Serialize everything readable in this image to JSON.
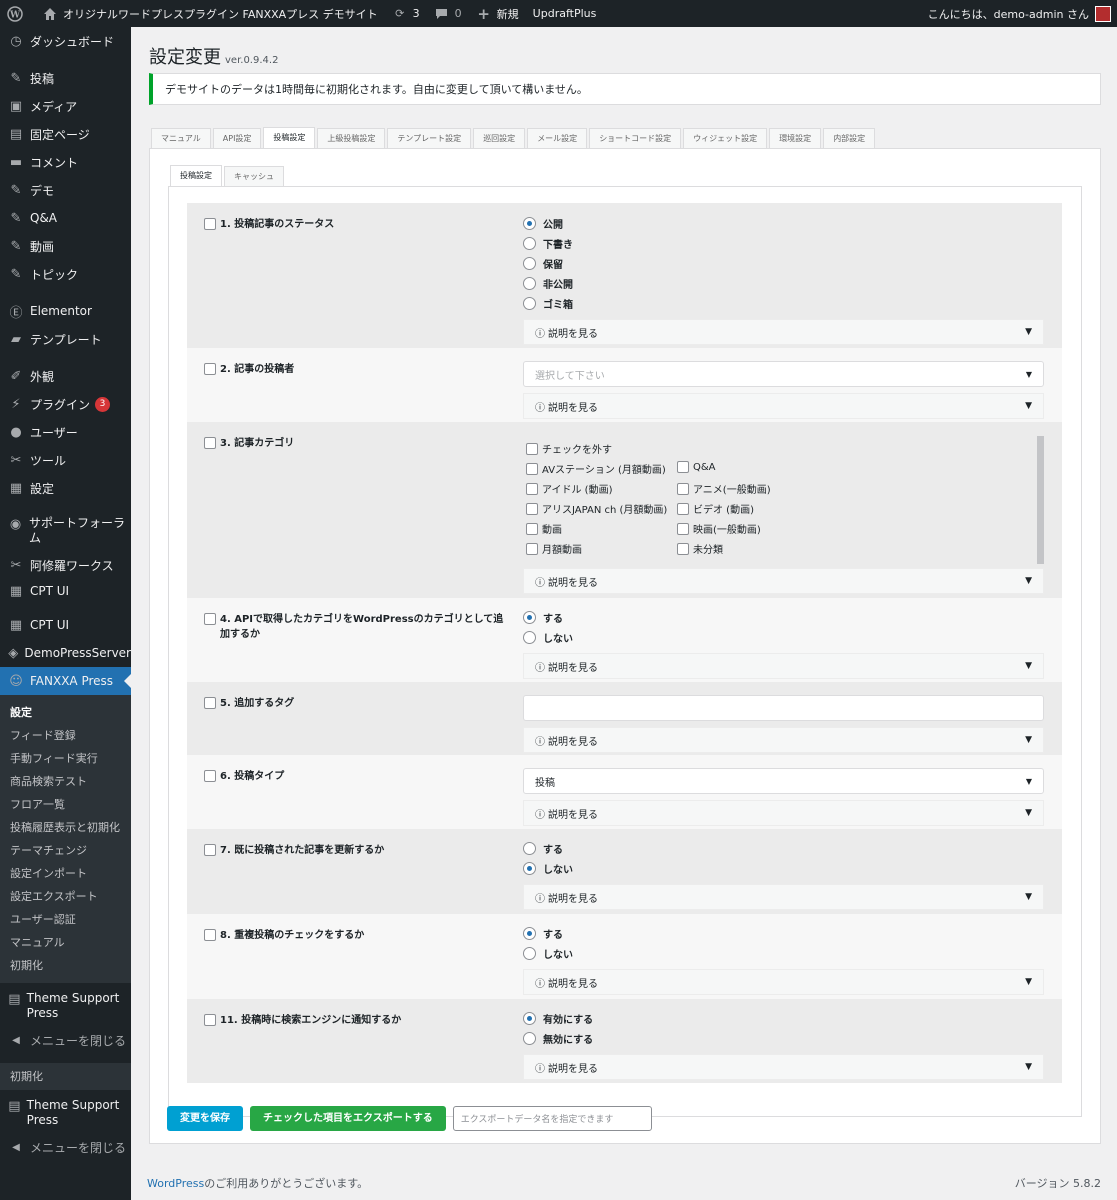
{
  "adminbar": {
    "site_name": "オリジナルワードプレスプラグイン FANXXAプレス デモサイト",
    "updates_count": "3",
    "comments_count": "0",
    "new_label": "新規",
    "plugin_label": "UpdraftPlus",
    "greeting": "こんにちは、demo-admin さん"
  },
  "sidebar": {
    "items": [
      {
        "label": "ダッシュボード",
        "icon": "dashboard-icon"
      },
      {
        "label": "投稿",
        "icon": "pin-icon"
      },
      {
        "label": "メディア",
        "icon": "media-icon"
      },
      {
        "label": "固定ページ",
        "icon": "page-icon"
      },
      {
        "label": "コメント",
        "icon": "comment-icon"
      },
      {
        "label": "デモ",
        "icon": "pin-icon"
      },
      {
        "label": "Q&A",
        "icon": "pin-icon"
      },
      {
        "label": "動画",
        "icon": "pin-icon"
      },
      {
        "label": "トピック",
        "icon": "pin-icon"
      },
      {
        "label": "Elementor",
        "icon": "elementor-icon"
      },
      {
        "label": "テンプレート",
        "icon": "folder-icon"
      },
      {
        "label": "外観",
        "icon": "brush-icon"
      },
      {
        "label": "プラグイン",
        "icon": "plugin-icon",
        "badge": "3"
      },
      {
        "label": "ユーザー",
        "icon": "user-icon"
      },
      {
        "label": "ツール",
        "icon": "wrench-icon"
      },
      {
        "label": "設定",
        "icon": "settings-icon"
      },
      {
        "label": "サポートフォーラム",
        "icon": "support-icon"
      },
      {
        "label": "阿修羅ワークス",
        "icon": "wrench-icon"
      },
      {
        "label": "CPT UI",
        "icon": "grid-icon"
      },
      {
        "label": "CPT UI",
        "icon": "grid-icon"
      },
      {
        "label": "DemoPressServer",
        "icon": "server-icon"
      },
      {
        "label": "FANXXA Press",
        "icon": "fanxxa-icon"
      }
    ],
    "submenu": [
      "設定",
      "フィード登録",
      "手動フィード実行",
      "商品検索テスト",
      "フロア一覧",
      "投稿履歴表示と初期化",
      "テーマチェンジ",
      "設定インポート",
      "設定エクスポート",
      "ユーザー認証",
      "マニュアル",
      "初期化"
    ],
    "theme_support": "Theme Support Press",
    "collapse": "メニューを閉じる",
    "reset_label": "初期化",
    "theme_support2": "Theme Support Press",
    "collapse2": "メニューを閉じる"
  },
  "page": {
    "title": "設定変更",
    "version": "ver.0.9.4.2",
    "notice": "デモサイトのデータは1時間毎に初期化されます。自由に変更して頂いて構いません。"
  },
  "tabs": [
    "マニュアル",
    "API設定",
    "投稿設定",
    "上級投稿設定",
    "テンプレート設定",
    "巡回設定",
    "メール設定",
    "ショートコード設定",
    "ウィジェット設定",
    "環境設定",
    "内部設定"
  ],
  "subtabs": [
    "投稿設定",
    "キャッシュ"
  ],
  "help_label": "説明を見る",
  "settings": {
    "s1": {
      "label": "1. 投稿記事のステータス",
      "options": [
        "公開",
        "下書き",
        "保留",
        "非公開",
        "ゴミ箱"
      ],
      "selected": "公開"
    },
    "s2": {
      "label": "2. 記事の投稿者",
      "placeholder": "選択して下さい"
    },
    "s3": {
      "label": "3. 記事カテゴリ",
      "uncheck": "チェックを外す",
      "categories_left": [
        "AVステーション (月額動画)",
        "アイドル (動画)",
        "アリスJAPAN ch (月額動画)",
        "動画",
        "月額動画"
      ],
      "categories_right": [
        "Q&A",
        "アニメ(一般動画)",
        "ビデオ (動画)",
        "映画(一般動画)",
        "未分類"
      ]
    },
    "s4": {
      "label": "4. APIで取得したカテゴリをWordPressのカテゴリとして追加するか",
      "options": [
        "する",
        "しない"
      ],
      "selected": "する"
    },
    "s5": {
      "label": "5. 追加するタグ",
      "value": ""
    },
    "s6": {
      "label": "6. 投稿タイプ",
      "value": "投稿"
    },
    "s7": {
      "label": "7. 既に投稿された記事を更新するか",
      "options": [
        "する",
        "しない"
      ],
      "selected": "しない"
    },
    "s8": {
      "label": "8. 重複投稿のチェックをするか",
      "options": [
        "する",
        "しない"
      ],
      "selected": "する"
    },
    "s11": {
      "label": "11. 投稿時に検索エンジンに通知するか",
      "options": [
        "有効にする",
        "無効にする"
      ],
      "selected": "有効にする"
    }
  },
  "buttons": {
    "save": "変更を保存",
    "export": "チェックした項目をエクスポートする",
    "export_placeholder": "エクスポートデータ名を指定できます"
  },
  "footer": {
    "wp_link": "WordPress",
    "thanks": "のご利用ありがとうございます。",
    "version": "バージョン 5.8.2"
  },
  "colors": {
    "admin_dark": "#1d2327",
    "accent": "#2271b1",
    "save_button": "#00a0d2",
    "export_button": "#28a745",
    "notice_border": "#00a32a"
  }
}
